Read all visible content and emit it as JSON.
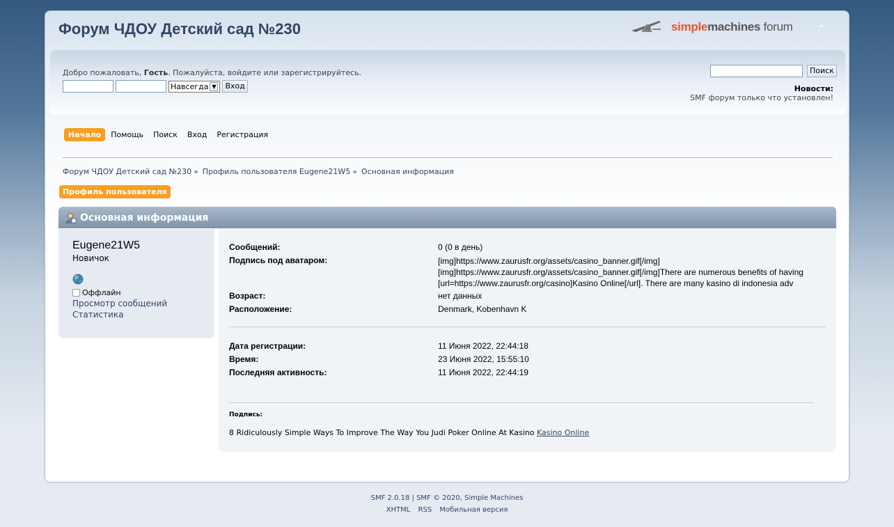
{
  "header": {
    "forum_title": "Форум ЧДОУ Детский сад №230",
    "logo": {
      "part1": "simple",
      "part2": "machines",
      "part3": " forum"
    }
  },
  "user_bar": {
    "welcome_prefix": "Добро пожаловать, ",
    "guest": "Гость",
    "please": ". Пожалуйста, ",
    "login_link": "войдите",
    "or": " или ",
    "register_link": "зарегистрируйтесь",
    "period": ".",
    "duration_value": "Навсегда",
    "login_button": "Вход",
    "search_button": "Поиск",
    "news_title": "Новости:",
    "news_text": "SMF форум только что установлен!"
  },
  "menu": {
    "items": [
      {
        "label": "Начало",
        "active": true
      },
      {
        "label": "Помощь"
      },
      {
        "label": "Поиск"
      },
      {
        "label": "Вход"
      },
      {
        "label": "Регистрация"
      }
    ]
  },
  "breadcrumb": [
    "Форум ЧДОУ Детский сад №230",
    "Профиль пользователя Eugene21W5",
    "Основная информация"
  ],
  "breadcrumb_sep": "»",
  "profile_tab": "Профиль пользователя",
  "section_title": "Основная информация",
  "profile": {
    "username": "Eugene21W5",
    "group": "Новичок",
    "status": "Оффлайн",
    "view_posts": "Просмотр сообщений",
    "stats": "Статистика"
  },
  "details": {
    "posts": {
      "label": "Сообщений:",
      "value": "0 (0 в день)"
    },
    "signature_avatar": {
      "label": "Подпись под аватаром:",
      "value": "[img]https://www.zaurusfr.org/assets/casino_banner.gif[/img] [img]https://www.zaurusfr.org/assets/casino_banner.gif[/img]There are numerous benefits of having [url=https://www.zaurusfr.org/casino]Kasino Online[/url]. There are many kasino di indonesia adv"
    },
    "age": {
      "label": "Возраст:",
      "value": "нет данных"
    },
    "location": {
      "label": "Расположение:",
      "value": "Denmark, Kobenhavn K"
    },
    "registered": {
      "label": "Дата регистрации:",
      "value": "11 Июня 2022, 22:44:18"
    },
    "local_time": {
      "label": "Время:",
      "value": "23 Июня 2022, 15:55:10"
    },
    "last_active": {
      "label": "Последняя активность:",
      "value": "11 Июня 2022, 22:44:19"
    }
  },
  "signature": {
    "label": "Подпись:",
    "text": "8 Ridiculously Simple Ways To Improve The Way You Judi Poker Online At Kasino ",
    "link": "Kasino Online"
  },
  "footer": {
    "smf_version": "SMF 2.0.18",
    "pipe": " | ",
    "copyright": "SMF © 2020",
    "comma": ", ",
    "simple_machines": "Simple Machines",
    "links": [
      "XHTML",
      "RSS",
      "Мобильная версия"
    ]
  },
  "colors": {
    "accent_orange": "#f89f22",
    "link": "#334466",
    "logo_orange": "#e8542b"
  }
}
